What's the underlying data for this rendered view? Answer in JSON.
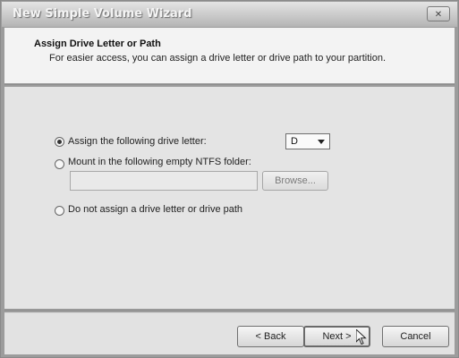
{
  "window": {
    "title": "New Simple Volume Wizard",
    "close_icon": "close-icon",
    "close_glyph": "✕"
  },
  "header": {
    "title": "Assign Drive Letter or Path",
    "subtitle": "For easier access, you can assign a drive letter or drive path to your partition."
  },
  "options": {
    "assign_letter": {
      "label": "Assign the following drive letter:",
      "selected": true
    },
    "mount_folder": {
      "label": "Mount in the following empty NTFS folder:",
      "selected": false
    },
    "no_assign": {
      "label": "Do not assign a drive letter or drive path",
      "selected": false
    }
  },
  "drive_letter": {
    "value": "D"
  },
  "folder_path": {
    "value": ""
  },
  "browse_button": {
    "label": "Browse..."
  },
  "buttons": {
    "back": "< Back",
    "next": "Next >",
    "cancel": "Cancel"
  },
  "cursor_icon": "mouse-pointer-icon"
}
